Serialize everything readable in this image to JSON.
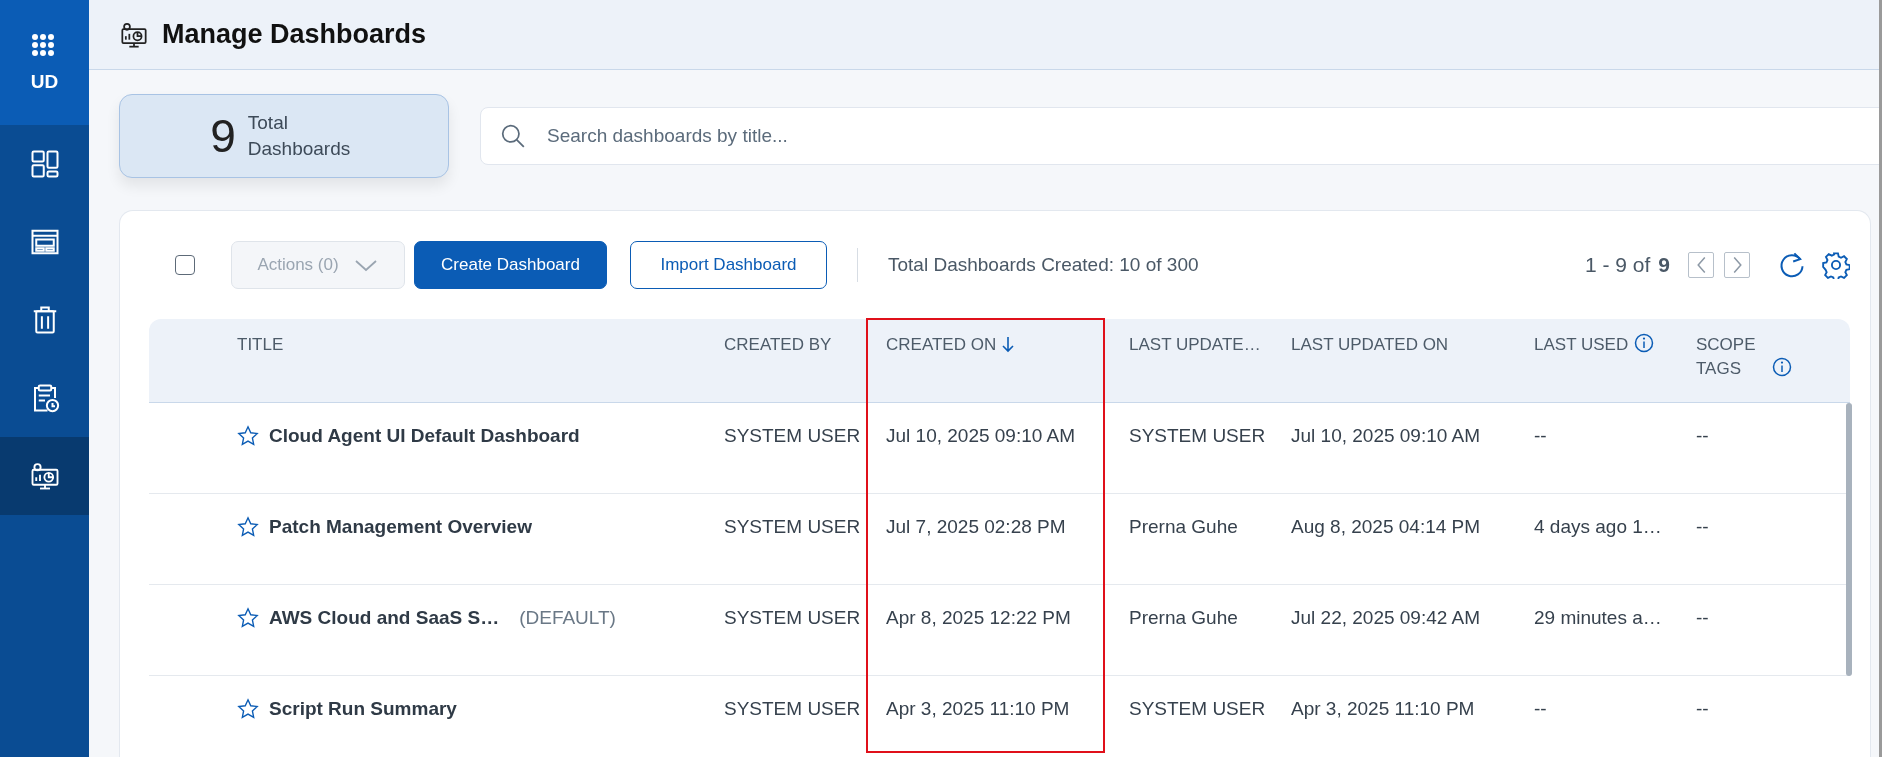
{
  "sidebar": {
    "brand": "UD",
    "items": [
      {
        "kind": "layout",
        "selected": false
      },
      {
        "kind": "window",
        "selected": false
      },
      {
        "kind": "trash",
        "selected": false
      },
      {
        "kind": "report",
        "selected": false
      },
      {
        "kind": "manage",
        "selected": true
      }
    ]
  },
  "header": {
    "title": "Manage Dashboards"
  },
  "summary": {
    "count": "9",
    "label": "Total Dashboards"
  },
  "search": {
    "placeholder": "Search dashboards by title..."
  },
  "toolbar": {
    "select_all_checked": false,
    "actions": {
      "label": "Actions (0)",
      "disabled": true
    },
    "create_button": "Create Dashboard",
    "import_button": "Import Dashboard",
    "quota": "Total Dashboards Created: 10 of 300",
    "range": "1 - 9 of",
    "total": "9"
  },
  "table": {
    "columns": [
      {
        "label": "TITLE",
        "sorted": false,
        "info": false,
        "highlighted": false
      },
      {
        "label": "CREATED BY",
        "sorted": false,
        "info": false,
        "highlighted": false
      },
      {
        "label": "CREATED ON",
        "sorted": true,
        "info": false,
        "highlighted": true
      },
      {
        "label": "LAST UPDATE…",
        "sorted": false,
        "info": false,
        "highlighted": false
      },
      {
        "label": "LAST UPDATED ON",
        "sorted": false,
        "info": false,
        "highlighted": false
      },
      {
        "label": "LAST USED",
        "sorted": false,
        "info": true,
        "highlighted": false
      },
      {
        "label": "SCOPE TAGS",
        "sorted": false,
        "info": true,
        "highlighted": false
      }
    ],
    "rows": [
      {
        "starred": false,
        "title": "Cloud Agent UI Default Dashboard",
        "created_by": "SYSTEM USER",
        "created_on": "Jul 10, 2025 09:10 AM",
        "last_updated_by": "SYSTEM USER",
        "last_updated_on": "Jul 10, 2025 09:10 AM",
        "last_used": "--",
        "scope_tags": "--"
      },
      {
        "starred": false,
        "title": "Patch Management Overview",
        "created_by": "SYSTEM USER",
        "created_on": "Jul 7, 2025 02:28 PM",
        "last_updated_by": "Prerna Guhe",
        "last_updated_on": "Aug 8, 2025 04:14 PM",
        "last_used": "4 days ago 1…",
        "scope_tags": "--"
      },
      {
        "starred": false,
        "title": "AWS Cloud and SaaS S…",
        "tag": "(DEFAULT)",
        "created_by": "SYSTEM USER",
        "created_on": "Apr 8, 2025 12:22 PM",
        "last_updated_by": "Prerna Guhe",
        "last_updated_on": "Jul 22, 2025 09:42 AM",
        "last_used": "29 minutes a…",
        "scope_tags": "--"
      },
      {
        "starred": false,
        "title": "Script Run Summary",
        "created_by": "SYSTEM USER",
        "created_on": "Apr 3, 2025 11:10 PM",
        "last_updated_by": "SYSTEM USER",
        "last_updated_on": "Apr 3, 2025 11:10 PM",
        "last_used": "--",
        "scope_tags": "--"
      }
    ]
  }
}
